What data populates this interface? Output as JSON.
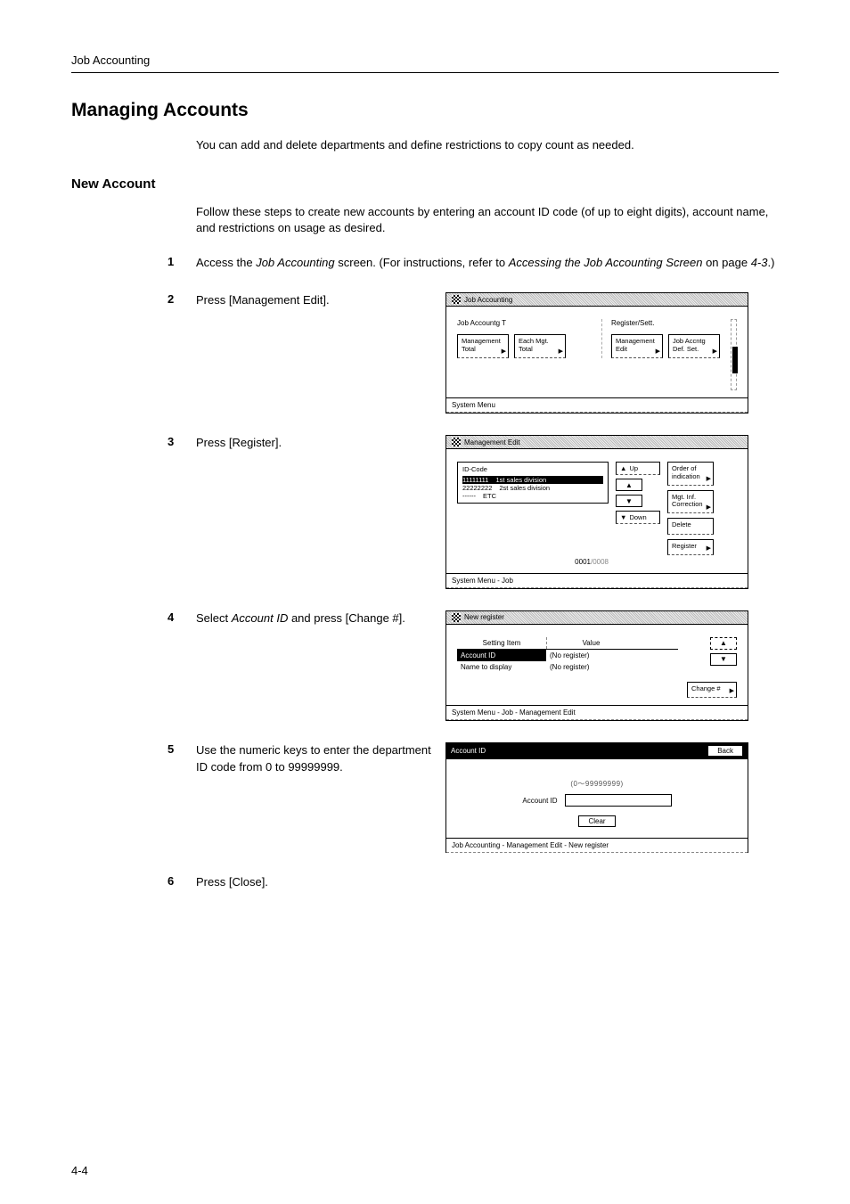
{
  "page": {
    "header": "Job Accounting",
    "title": "Managing Accounts",
    "intro": "You can add and delete departments and define restrictions to copy count as needed.",
    "sub_title": "New Account",
    "sub_intro": "Follow these steps to create new accounts by entering an account ID code (of up to eight digits), account name, and restrictions on usage as desired.",
    "page_number": "4-4"
  },
  "steps": {
    "s1": {
      "prefix": "Access the ",
      "italic1": "Job Accounting",
      "mid": " screen. (For instructions, refer to ",
      "italic2": "Accessing the Job Accounting Screen",
      "suffix": " on page ",
      "italic3": "4-3",
      "end": ".)"
    },
    "s2": "Press [Management Edit].",
    "s3": "Press [Register].",
    "s4_prefix": "Select ",
    "s4_italic": "Account ID",
    "s4_suffix": " and press [Change #].",
    "s5": "Use the numeric keys to enter the department ID code from 0 to 99999999.",
    "s6": "Press [Close]."
  },
  "screen1": {
    "title": "Job Accounting",
    "left_label": "Job Accountg T",
    "right_label": "Register/Sett.",
    "btn_mgmt_total": "Management Total",
    "btn_each_mgt": "Each Mgt. Total",
    "btn_mgmt_edit": "Management Edit",
    "btn_job_def": "Job Accntg Def. Set.",
    "footer": "System Menu"
  },
  "screen2": {
    "title": "Management Edit",
    "list_header": "ID-Code",
    "rows": [
      {
        "code": "11111111",
        "name": "1st sales division"
      },
      {
        "code": "22222222",
        "name": "2st sales division"
      },
      {
        "code": "------",
        "name": "ETC"
      }
    ],
    "btn_up": "Up",
    "btn_down": "Down",
    "btn_order": "Order of indication",
    "btn_mgtinf": "Mgt. Inf. Correction",
    "btn_delete": "Delete",
    "btn_register": "Register",
    "counter_a": "0001",
    "counter_b": "/0008",
    "footer": "System Menu       -   Job"
  },
  "screen3": {
    "title": "New register",
    "col1": "Setting Item",
    "col2": "Value",
    "rows": [
      {
        "item": "Account ID",
        "value": "(No register)"
      },
      {
        "item": "Name to display",
        "value": "(No register)"
      }
    ],
    "btn_change": "Change #",
    "footer": "System Menu       -   Job                        -   Management Edit"
  },
  "screen4": {
    "title": "Account ID",
    "back": "Back",
    "range": "(0～99999999)",
    "label": "Account ID",
    "clear": "Clear",
    "footer": "Job Accounting   -   Management Edit    -   New register"
  }
}
